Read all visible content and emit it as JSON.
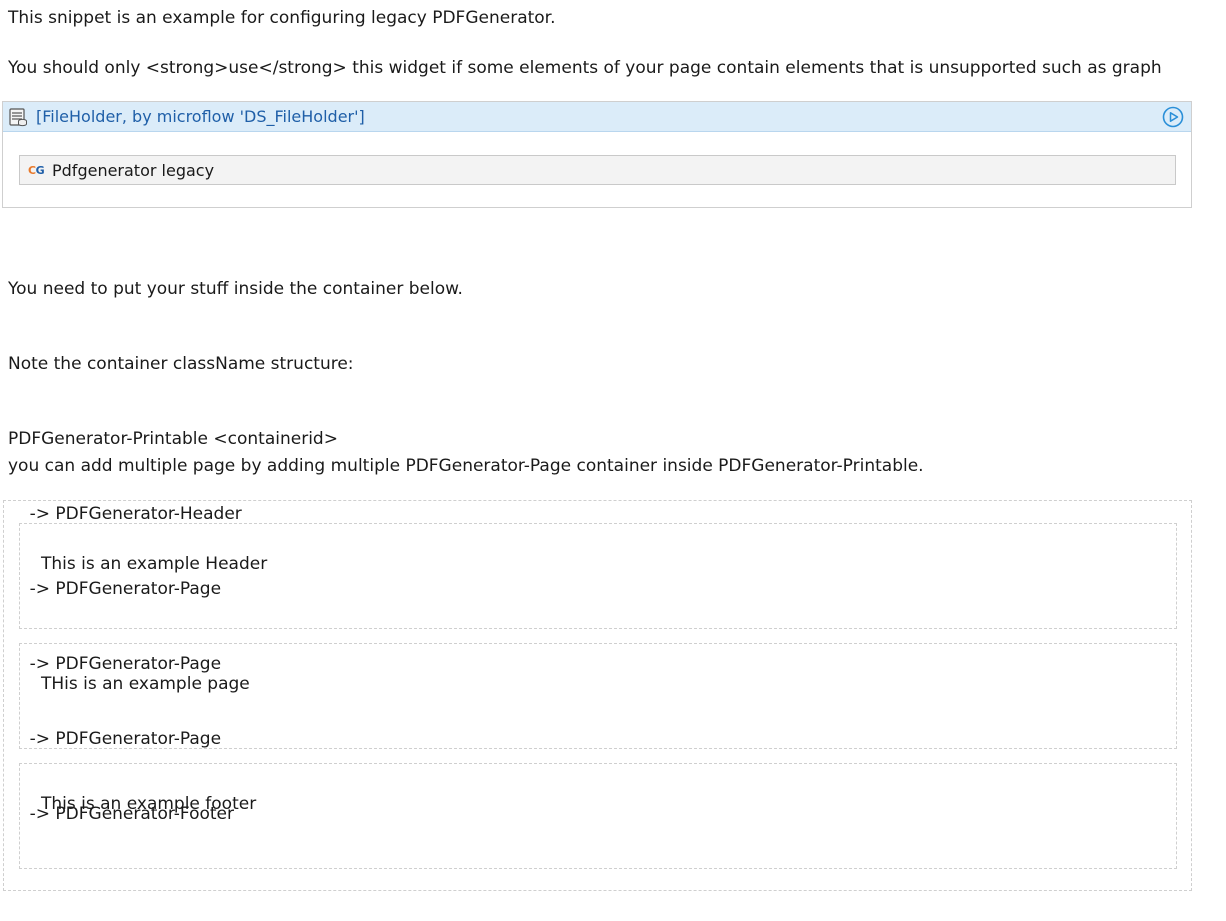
{
  "intro": {
    "line1": "This snippet is an example for configuring legacy PDFGenerator.",
    "line2": "You should only <strong>use</strong> this widget if some elements of your page contain elements that is unsupported such as graph"
  },
  "dataview": {
    "title": "[FileHolder, by microflow 'DS_FileHolder']",
    "icon": "dataview-icon",
    "action_icon": "play-circle-icon",
    "widget": {
      "icon_text_c": "C",
      "icon_text_g": "G",
      "label": "Pdfgenerator legacy"
    }
  },
  "notes": {
    "lines": [
      "You need to put your stuff inside the container below.",
      "Note the container className structure:",
      "PDFGenerator-Printable <containerid>",
      "    -> PDFGenerator-Header",
      "    -> PDFGenerator-Page",
      "    -> PDFGenerator-Page",
      "    -> PDFGenerator-Page",
      "    -> PDFGenerator-Footer"
    ],
    "multi_page": "you can add multiple page by adding multiple PDFGenerator-Page container inside PDFGenerator-Printable."
  },
  "containers": {
    "header_text": "This is an example Header",
    "page_text": "THis is an example page",
    "footer_text": "This is an example footer"
  },
  "colors": {
    "header_bg": "#dbecf9",
    "link_blue": "#1f5fa8",
    "dashed_border": "#cfcfcf"
  }
}
